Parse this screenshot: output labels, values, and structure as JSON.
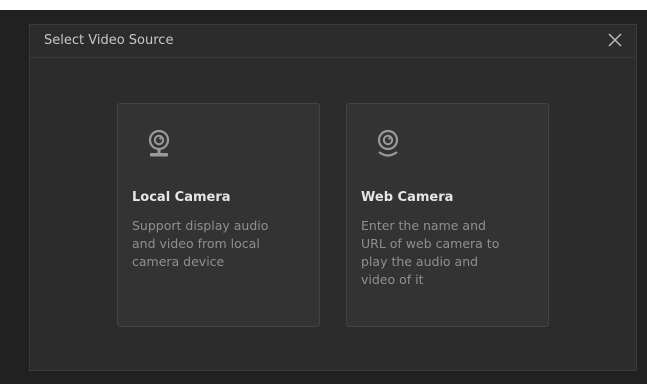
{
  "dialog": {
    "title": "Select Video Source",
    "close_icon": "close-icon"
  },
  "cards": [
    {
      "icon": "webcam-icon",
      "title": "Local Camera",
      "description": "Support display audio\nand video from local\ncamera device"
    },
    {
      "icon": "webcam-icon",
      "title": "Web Camera",
      "description": "Enter the name and\nURL of web camera to\nplay the audio and\nvideo of it"
    }
  ],
  "colors": {
    "backdrop": "#212121",
    "dialog_bg": "#2c2c2c",
    "card_bg": "#333333",
    "title_text": "#c8c8c8",
    "card_title": "#e6e6e6",
    "card_desc": "#8f8f8f",
    "icon": "#9a9a9a"
  }
}
